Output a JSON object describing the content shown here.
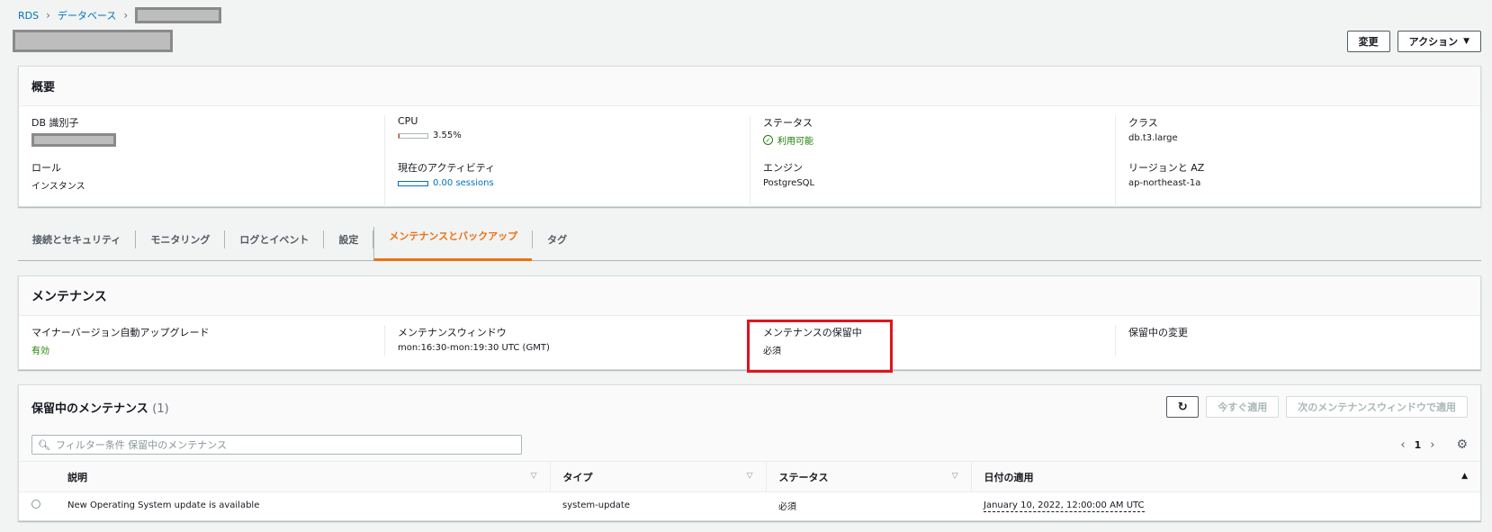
{
  "breadcrumb": {
    "root": "RDS",
    "databases": "データベース"
  },
  "actions": {
    "modify": "変更",
    "actions": "アクション"
  },
  "summary": {
    "title": "概要",
    "db_id_label": "DB 識別子",
    "cpu_label": "CPU",
    "cpu_value": "3.55%",
    "cpu_fraction": 0.0355,
    "status_label": "ステータス",
    "status_value": "利用可能",
    "class_label": "クラス",
    "class_value": "db.t3.large",
    "role_label": "ロール",
    "role_value": "インスタンス",
    "activity_label": "現在のアクティビティ",
    "activity_value": "0.00 sessions",
    "engine_label": "エンジン",
    "engine_value": "PostgreSQL",
    "region_label": "リージョンと AZ",
    "region_value": "ap-northeast-1a"
  },
  "tabs": [
    {
      "label": "接続とセキュリティ"
    },
    {
      "label": "モニタリング"
    },
    {
      "label": "ログとイベント"
    },
    {
      "label": "設定"
    },
    {
      "label": "メンテナンスとバックアップ",
      "active": true
    },
    {
      "label": "タグ"
    }
  ],
  "maintenance": {
    "title": "メンテナンス",
    "auto_upgrade_label": "マイナーバージョン自動アップグレード",
    "auto_upgrade_value": "有効",
    "window_label": "メンテナンスウィンドウ",
    "window_value": "mon:16:30-mon:19:30 UTC (GMT)",
    "pending_label": "メンテナンスの保留中",
    "pending_value": "必須",
    "pending_changes_label": "保留中の変更"
  },
  "pending": {
    "title": "保留中のメンテナンス",
    "count": "(1)",
    "apply_now": "今すぐ適用",
    "apply_next": "次のメンテナンスウィンドウで適用",
    "filter_placeholder": "フィルター条件 保留中のメンテナンス",
    "page": "1",
    "columns": {
      "description": "説明",
      "type": "タイプ",
      "status": "ステータス",
      "apply_date": "日付の適用"
    },
    "rows": [
      {
        "description": "New Operating System update is available",
        "type": "system-update",
        "status": "必須",
        "apply_date": "January 10, 2022, 12:00:00 AM UTC"
      }
    ]
  },
  "colors": {
    "link": "#0073bb",
    "accent": "#ec7211",
    "success": "#1d8102",
    "highlight": "#e0141e"
  }
}
